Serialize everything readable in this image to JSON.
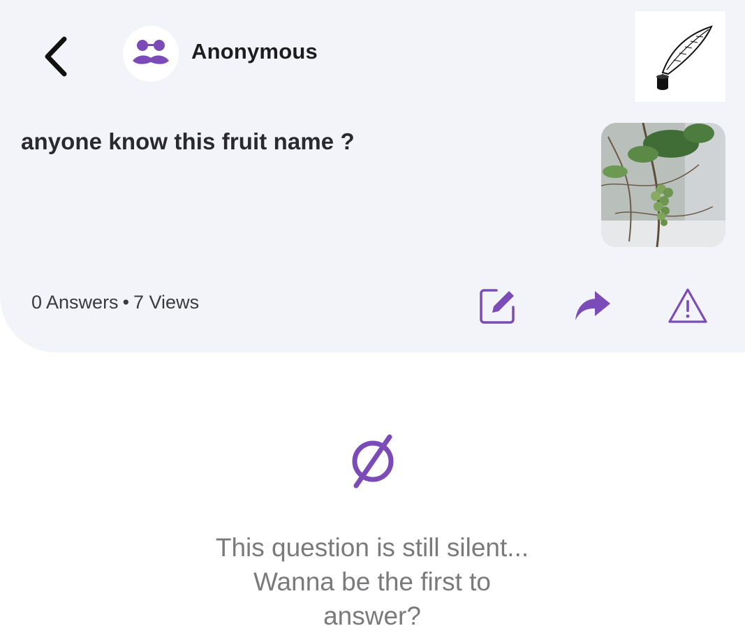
{
  "colors": {
    "accent": "#7b4bb7",
    "card_background": "#f3f4f9",
    "title_text": "#2a2a2e",
    "muted_text": "#7a7a7c"
  },
  "header": {
    "back_icon": "chevron-left-icon",
    "avatar_icon": "incognito-glasses-mustache-icon",
    "username": "Anonymous",
    "app_logo_icon": "quill-inkwell-icon"
  },
  "question": {
    "text": "anyone know this fruit name ?",
    "image_description_icon": "grape-vine-photo"
  },
  "stats": {
    "answers": "0 Answers",
    "separator": "•",
    "views": "7 Views"
  },
  "actions": [
    {
      "icon": "edit-icon"
    },
    {
      "icon": "share-icon"
    },
    {
      "icon": "report-warning-icon"
    }
  ],
  "empty_state": {
    "icon": "empty-set-icon",
    "line1": "This question is still silent...",
    "line2": "Wanna be the first to",
    "line3": "answer?"
  }
}
